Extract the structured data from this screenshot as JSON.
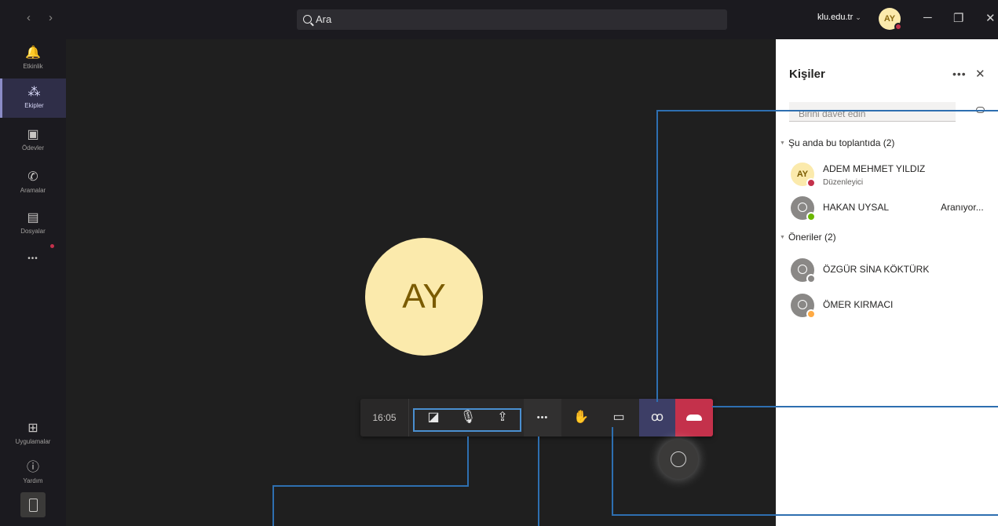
{
  "titlebar": {
    "back": "‹",
    "forward": "›",
    "search_placeholder": "Ara",
    "org": "klu.edu.tr",
    "org_chevron": "⌄",
    "avatar_initials": "AY",
    "minimize": "─",
    "maximize": "❐",
    "close": "✕"
  },
  "rail": {
    "items": [
      {
        "label": "Etkinlik",
        "icon": "bell-icon",
        "glyph": "🔔"
      },
      {
        "label": "Ekipler",
        "icon": "teams-icon",
        "glyph": "⁂"
      },
      {
        "label": "Ödevler",
        "icon": "assignments-icon",
        "glyph": "▣"
      },
      {
        "label": "Aramalar",
        "icon": "phone-icon",
        "glyph": "✆"
      },
      {
        "label": "Dosyalar",
        "icon": "files-icon",
        "glyph": "▤"
      },
      {
        "label": "",
        "icon": "more-icon",
        "glyph": "•••"
      }
    ],
    "bottom": [
      {
        "label": "Uygulamalar",
        "icon": "apps-icon",
        "glyph": "⊞"
      },
      {
        "label": "Yardım",
        "icon": "help-icon",
        "glyph": "ⓘ"
      }
    ]
  },
  "stage": {
    "avatar_initials": "AY",
    "toolbar": {
      "timer": "16:05",
      "camera_glyph": "◪",
      "mic_glyph": "🎙",
      "share_glyph": "⇪",
      "more_glyph": "•••",
      "raise_hand_glyph": "✋",
      "chat_glyph": "▭",
      "people_glyph": "ꝏ"
    }
  },
  "panel": {
    "title": "Kişiler",
    "more": "•••",
    "close": "✕",
    "invite_placeholder": "Birini davet edin",
    "sections": [
      {
        "label": "Şu anda bu toplantıda (2)"
      },
      {
        "label": "Öneriler (2)"
      }
    ],
    "people": [
      {
        "initials": "AY",
        "name": "ADEM MEHMET YILDIZ",
        "role": "Düzenleyici",
        "state": "",
        "status_color": "#c4314b"
      },
      {
        "initials": "",
        "name": "HAKAN UYSAL",
        "role": "",
        "state": "Aranıyor...",
        "status_color": "#6bb700"
      },
      {
        "initials": "",
        "name": "ÖZGÜR SİNA KÖKTÜRK",
        "role": "",
        "state": "",
        "status_color": "#8a8886"
      },
      {
        "initials": "",
        "name": "ÖMER KIRMACI",
        "role": "",
        "state": "",
        "status_color": "#ffaa44"
      }
    ]
  },
  "colors": {
    "accent": "#6264a7",
    "hangup": "#c4314b",
    "annotation": "#2e6fb0",
    "avatar_bg": "#fbeaac"
  }
}
